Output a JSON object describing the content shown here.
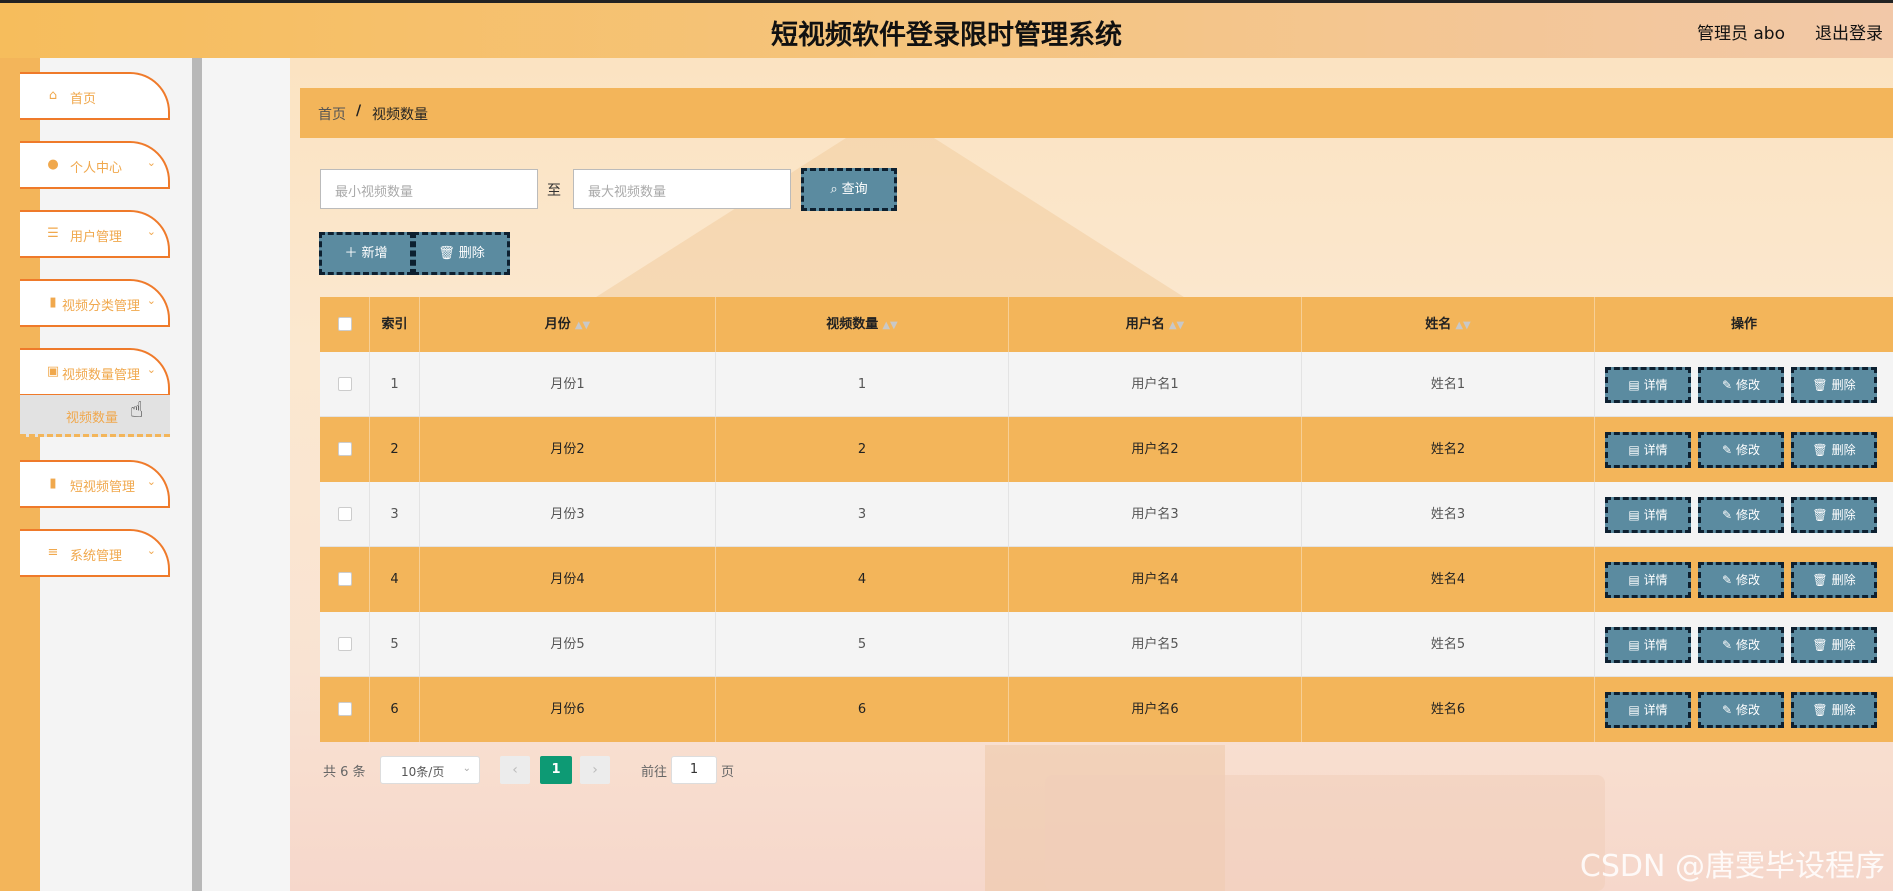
{
  "header": {
    "title": "短视频软件登录限时管理系统",
    "user": "管理员 abo",
    "logout": "退出登录"
  },
  "sidebar": {
    "items": [
      {
        "label": "首页",
        "icon": "home-icon",
        "glyph": "⌂",
        "expand": false
      },
      {
        "label": "个人中心",
        "icon": "person-icon",
        "glyph": "●",
        "expand": true
      },
      {
        "label": "用户管理",
        "icon": "sliders-icon",
        "glyph": "☰",
        "expand": true
      },
      {
        "label": "视频分类管理",
        "icon": "bar-chart-icon",
        "glyph": "▮",
        "expand": true
      },
      {
        "label": "视频数量管理",
        "icon": "chart-icon",
        "glyph": "▣",
        "expand": true
      },
      {
        "label": "短视频管理",
        "icon": "bars-icon",
        "glyph": "▮",
        "expand": true
      },
      {
        "label": "系统管理",
        "icon": "menu-icon",
        "glyph": "≡",
        "expand": true
      }
    ],
    "submenu": {
      "label": "视频数量"
    }
  },
  "breadcrumb": {
    "home": "首页",
    "sep": "/",
    "current": "视频数量"
  },
  "search": {
    "min_placeholder": "最小视频数量",
    "to": "至",
    "max_placeholder": "最大视频数量",
    "query": "查询"
  },
  "toolbar": {
    "add": "新增",
    "delete": "删除"
  },
  "table": {
    "columns": [
      "索引",
      "月份",
      "视频数量",
      "用户名",
      "姓名",
      "操作"
    ],
    "rows": [
      {
        "index": "1",
        "month": "月份1",
        "count": "1",
        "username": "用户名1",
        "name": "姓名1"
      },
      {
        "index": "2",
        "month": "月份2",
        "count": "2",
        "username": "用户名2",
        "name": "姓名2"
      },
      {
        "index": "3",
        "month": "月份3",
        "count": "3",
        "username": "用户名3",
        "name": "姓名3"
      },
      {
        "index": "4",
        "month": "月份4",
        "count": "4",
        "username": "用户名4",
        "name": "姓名4"
      },
      {
        "index": "5",
        "month": "月份5",
        "count": "5",
        "username": "用户名5",
        "name": "姓名5"
      },
      {
        "index": "6",
        "month": "月份6",
        "count": "6",
        "username": "用户名6",
        "name": "姓名6"
      }
    ],
    "actions": {
      "detail": "详情",
      "edit": "修改",
      "delete": "删除"
    }
  },
  "pagination": {
    "total": "共 6 条",
    "page_size": "10条/页",
    "current": "1",
    "goto": "前往",
    "goto_value": "1",
    "page_unit": "页"
  },
  "watermark": "CSDN @唐雯毕设程序",
  "colors": {
    "accent": "#f3b55a",
    "button": "#5b8ba0",
    "active_page": "#0d9a74",
    "menu_border": "#ef7a2a"
  }
}
